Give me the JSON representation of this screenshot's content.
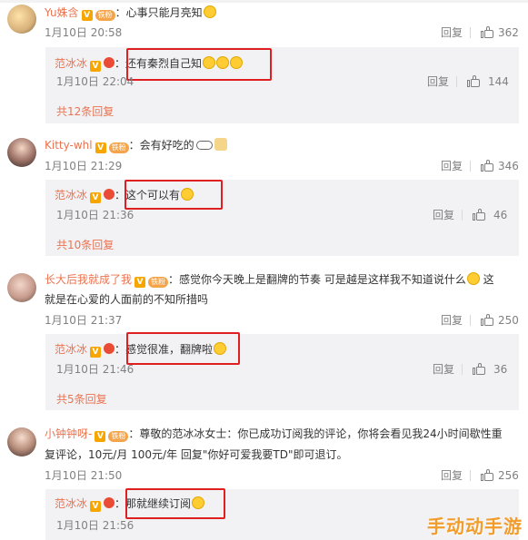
{
  "comments": [
    {
      "user": "Yu姝含",
      "text": "：心事只能月亮知",
      "time": "1月10日 20:58",
      "reply_label": "回复",
      "likes": "362",
      "badge_fan": "铁粉",
      "reply": {
        "user": "范冰冰",
        "text": "：还有秦烈自己知",
        "time": "1月10日 22:04",
        "reply_label": "回复",
        "likes": "144"
      },
      "more": "共12条回复"
    },
    {
      "user": "Kitty-whl",
      "text": "：会有好吃的",
      "time": "1月10日 21:29",
      "reply_label": "回复",
      "likes": "346",
      "badge_fan": "铁粉",
      "reply": {
        "user": "范冰冰",
        "text": "：这个可以有",
        "time": "1月10日 21:36",
        "reply_label": "回复",
        "likes": "46"
      },
      "more": "共10条回复"
    },
    {
      "user": "长大后我就成了我",
      "text": "：感觉你今天晚上是翻牌的节奏 可是越是这样我不知道说什么",
      "text2": "这",
      "text_line2": "就是在心爱的人面前的不知所措吗",
      "time": "1月10日 21:37",
      "reply_label": "回复",
      "likes": "250",
      "badge_fan": "铁粉",
      "reply": {
        "user": "范冰冰",
        "text": "：感觉很准，翻牌啦",
        "time": "1月10日 21:46",
        "reply_label": "回复",
        "likes": "36"
      },
      "more": "共5条回复"
    },
    {
      "user": "小钟钟呀-",
      "text": "：尊敬的范冰冰女士：你已成功订阅我的评论，你将会看见我24小时间歇性重",
      "text_line2": "复评论，10元/月 100元/年 回复\"你好可爱我要TD\"即可退订。",
      "time": "1月10日 21:50",
      "reply_label": "回复",
      "likes": "256",
      "badge_fan": "铁粉",
      "reply": {
        "user": "范冰冰",
        "text": "：那就继续订阅",
        "time": "1月10日 21:56"
      }
    }
  ],
  "vip_mark": "V",
  "watermark": "手动动手游",
  "colors": {
    "username": "#eb7350",
    "highlight_box": "#e02020",
    "reply_bg": "#f2f2f5",
    "muted": "#808080"
  }
}
